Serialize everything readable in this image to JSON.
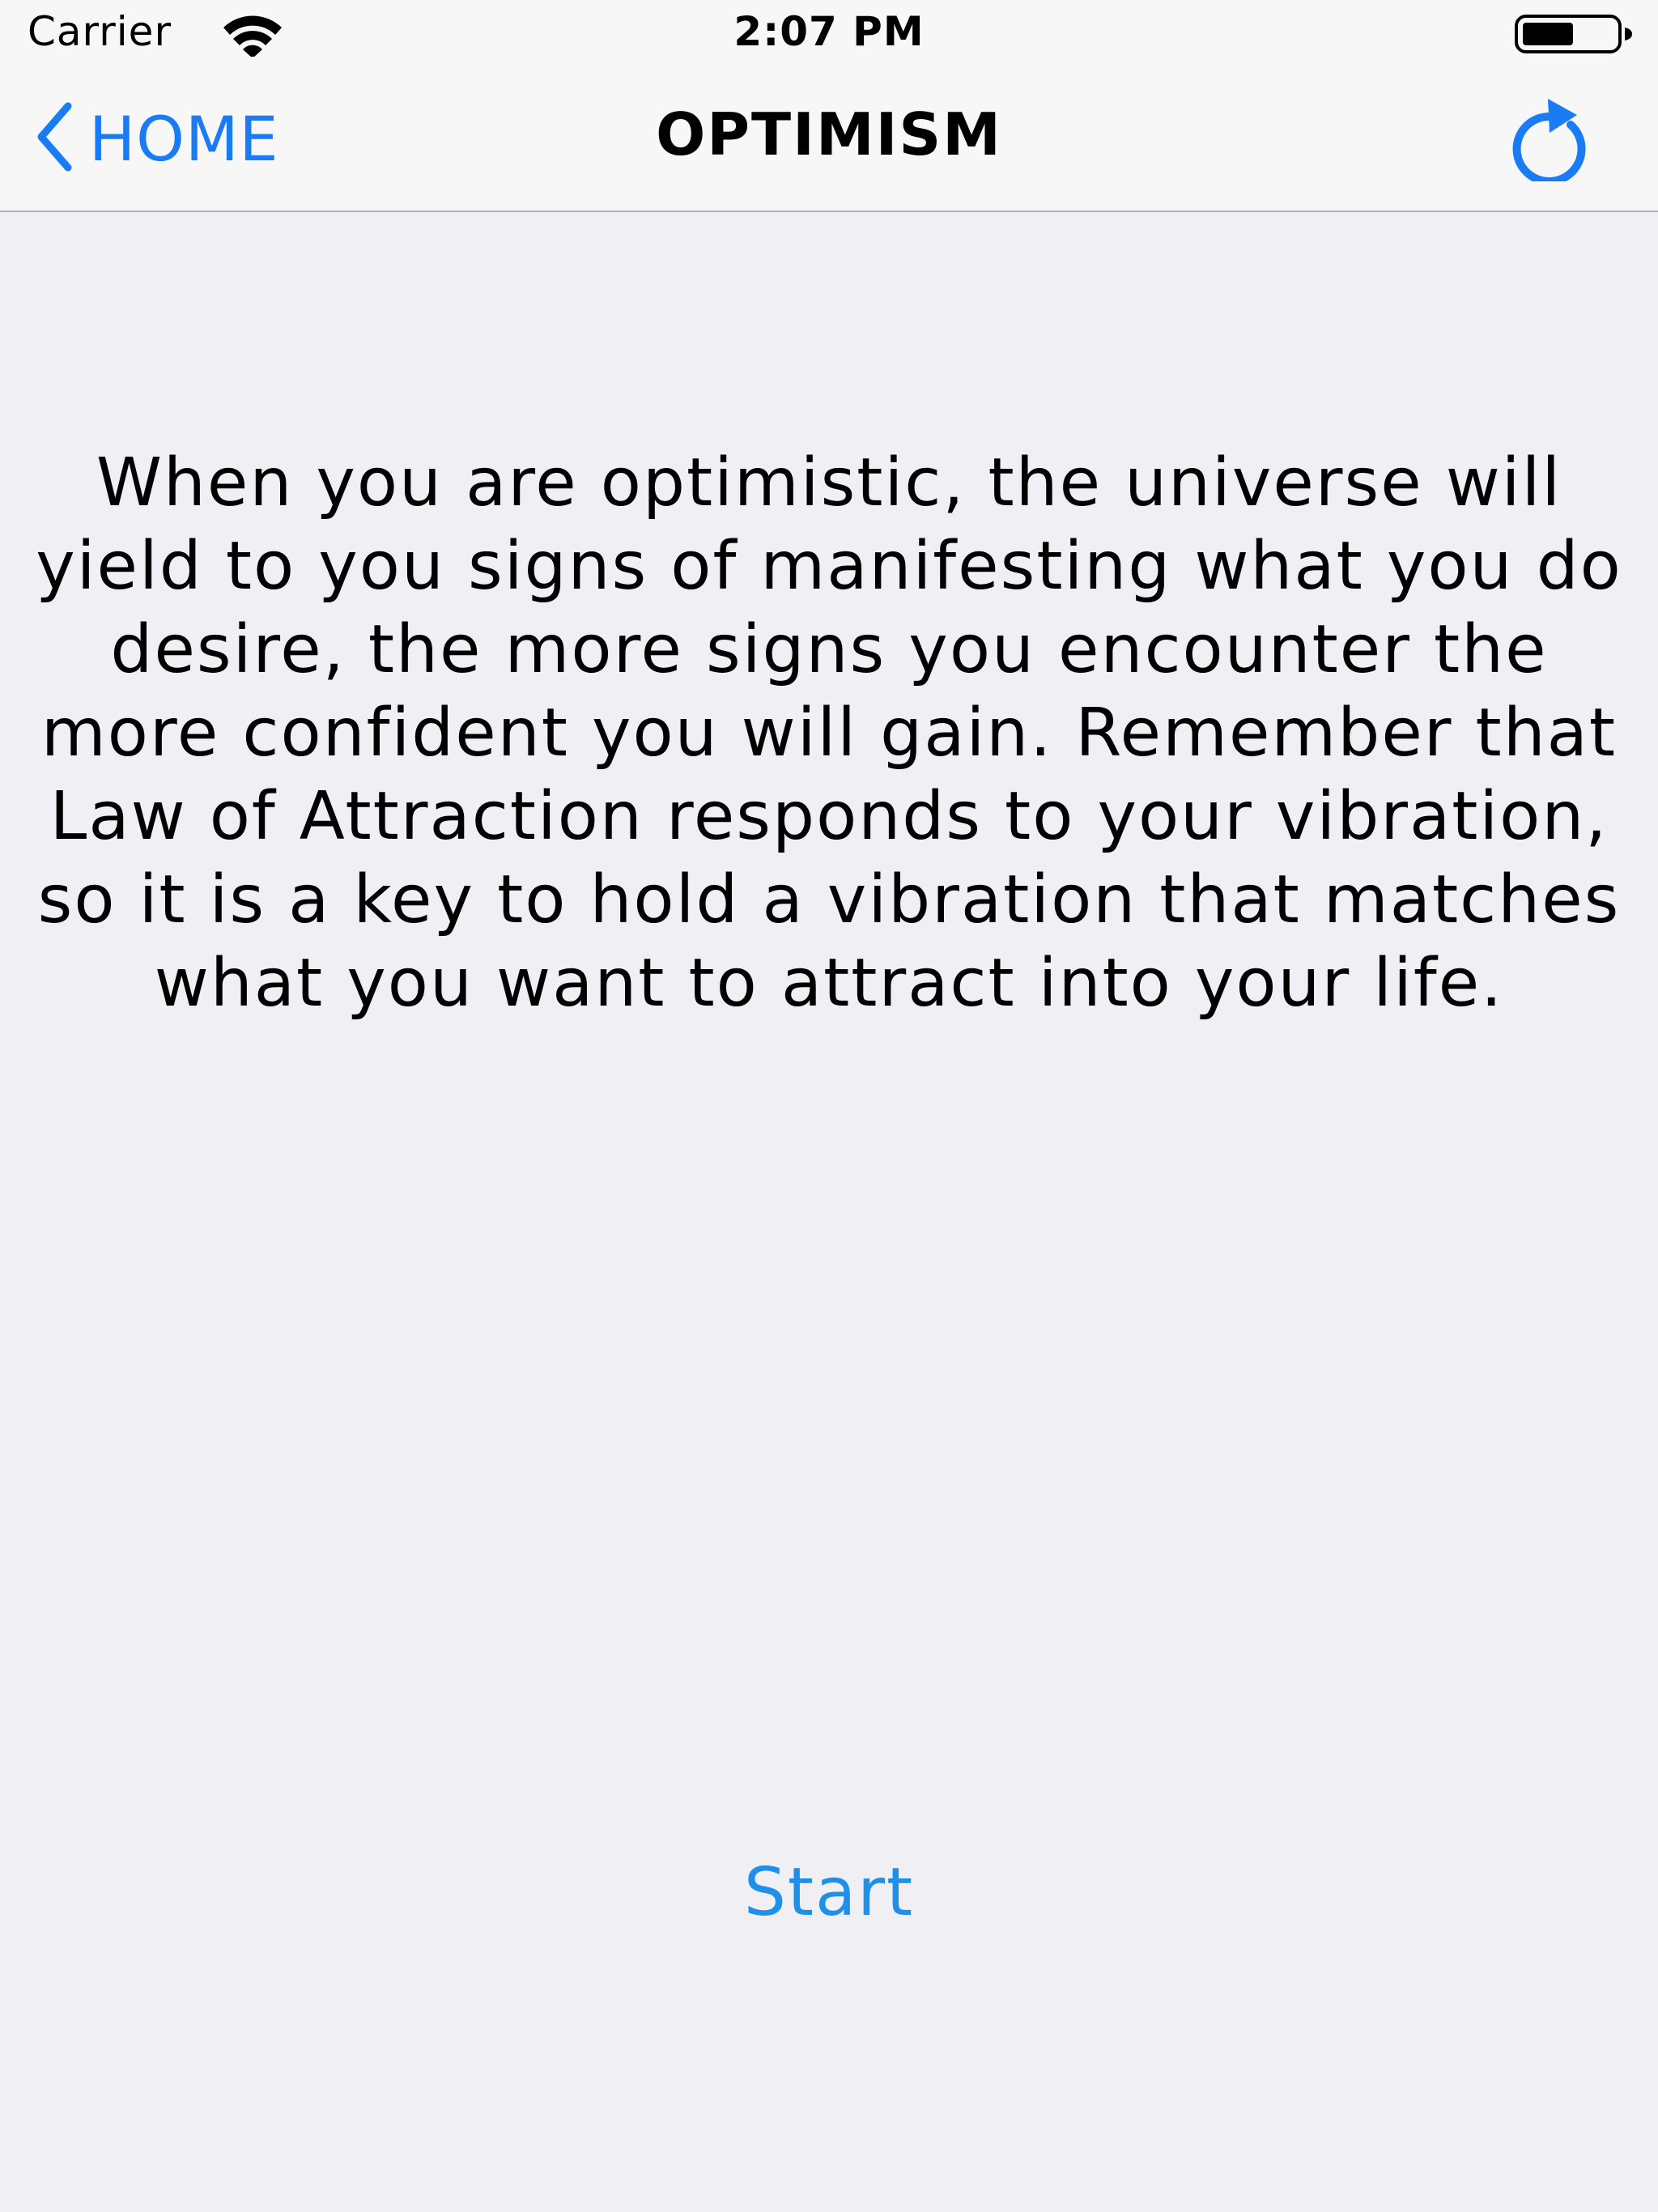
{
  "status_bar": {
    "carrier": "Carrier",
    "time": "2:07 PM",
    "wifi_icon": "wifi-icon",
    "battery_icon": "battery-icon"
  },
  "nav": {
    "back_icon": "chevron-left-icon",
    "back_label": "HOME",
    "title": "OPTIMISM",
    "refresh_icon": "refresh-icon"
  },
  "content": {
    "quote": "When you are optimistic, the universe will yield to you signs of manifesting what you do desire, the more signs you encounter the more confident you will gain. Remember that Law of Attraction responds to your vibration, so it is a key to hold a vibration that matches what you want to attract into your life."
  },
  "actions": {
    "start_label": "Start"
  },
  "colors": {
    "accent": "#1a7cf5",
    "start_button": "#1e90ea",
    "background": "#efeff4",
    "bar_background": "#f7f7f7"
  }
}
